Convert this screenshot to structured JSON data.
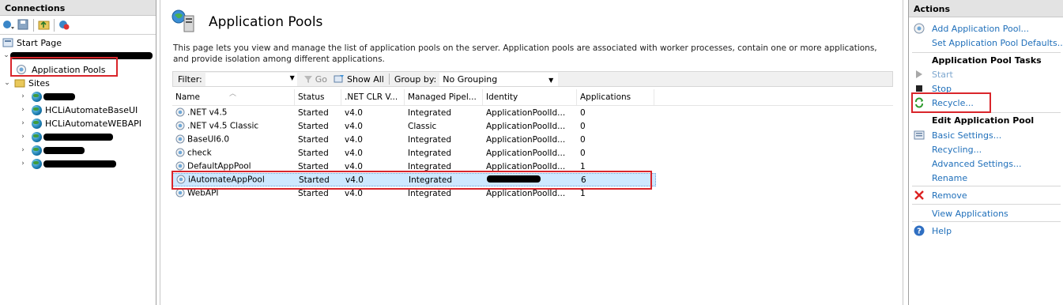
{
  "connections": {
    "title": "Connections",
    "start_page": "Start Page",
    "app_pools": "Application Pools",
    "sites": "Sites",
    "site_items": [
      "HCLiAutomateBaseUI",
      "HCLiAutomateWEBAPI"
    ]
  },
  "main": {
    "title": "Application Pools",
    "description": "This page lets you view and manage the list of application pools on the server. Application pools are associated with worker processes, contain one or more applications, and provide isolation among different applications.",
    "filter_label": "Filter:",
    "filter_value": "",
    "go_label": "Go",
    "show_all_label": "Show All",
    "group_by_label": "Group by:",
    "group_by_value": "No Grouping",
    "columns": [
      "Name",
      "Status",
      ".NET CLR V...",
      "Managed Pipel...",
      "Identity",
      "Applications"
    ],
    "rows": [
      {
        "name": ".NET v4.5",
        "status": "Started",
        "clr": "v4.0",
        "pipeline": "Integrated",
        "identity": "ApplicationPoolId...",
        "apps": "0"
      },
      {
        "name": ".NET v4.5 Classic",
        "status": "Started",
        "clr": "v4.0",
        "pipeline": "Classic",
        "identity": "ApplicationPoolId...",
        "apps": "0"
      },
      {
        "name": "BaseUI6.0",
        "status": "Started",
        "clr": "v4.0",
        "pipeline": "Integrated",
        "identity": "ApplicationPoolId...",
        "apps": "0"
      },
      {
        "name": "check",
        "status": "Started",
        "clr": "v4.0",
        "pipeline": "Integrated",
        "identity": "ApplicationPoolId...",
        "apps": "0"
      },
      {
        "name": "DefaultAppPool",
        "status": "Started",
        "clr": "v4.0",
        "pipeline": "Integrated",
        "identity": "ApplicationPoolId...",
        "apps": "1"
      },
      {
        "name": "iAutomateAppPool",
        "status": "Started",
        "clr": "v4.0",
        "pipeline": "Integrated",
        "identity": "",
        "apps": "6"
      },
      {
        "name": "WebAPI",
        "status": "Started",
        "clr": "v4.0",
        "pipeline": "Integrated",
        "identity": "ApplicationPoolId...",
        "apps": "1"
      }
    ]
  },
  "actions": {
    "title": "Actions",
    "add_pool": "Add Application Pool...",
    "set_defaults": "Set Application Pool Defaults...",
    "tasks_heading": "Application Pool Tasks",
    "start": "Start",
    "stop": "Stop",
    "recycle": "Recycle...",
    "edit_heading": "Edit Application Pool",
    "basic_settings": "Basic Settings...",
    "recycling": "Recycling...",
    "advanced_settings": "Advanced Settings...",
    "rename": "Rename",
    "remove": "Remove",
    "view_apps": "View Applications",
    "help": "Help"
  },
  "colors": {
    "highlight": "#d9252b",
    "link": "#1f6fba",
    "selection": "#cde8ff"
  }
}
